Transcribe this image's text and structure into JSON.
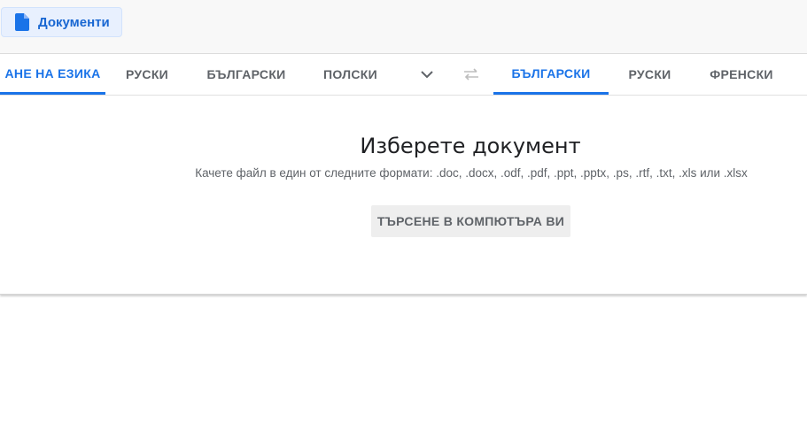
{
  "header": {
    "documents_label": "Документи"
  },
  "source_languages": [
    {
      "label": "АНЕ НА ЕЗИКА",
      "active": true
    },
    {
      "label": "РУСКИ",
      "active": false
    },
    {
      "label": "БЪЛГАРСКИ",
      "active": false
    },
    {
      "label": "ПОЛСКИ",
      "active": false
    }
  ],
  "target_languages": [
    {
      "label": "БЪЛГАРСКИ",
      "active": true
    },
    {
      "label": "РУСКИ",
      "active": false
    },
    {
      "label": "ФРЕНСКИ",
      "active": false
    }
  ],
  "icons": {
    "document": "document-icon",
    "more_languages": "chevron-down-icon",
    "swap": "swap-languages-icon"
  },
  "upload": {
    "title": "Изберете документ",
    "subtitle": "Качете файл в един от следните формати: .doc, .docx, .odf, .pdf, .ppt, .pptx, .ps, .rtf, .txt, .xls или .xlsx",
    "button_label": "ТЪРСЕНЕ В КОМПЮТЪРА ВИ"
  },
  "colors": {
    "accent": "#1a73e8",
    "tab_text": "#5f6368",
    "doc_button_bg": "#e8f0fe"
  }
}
